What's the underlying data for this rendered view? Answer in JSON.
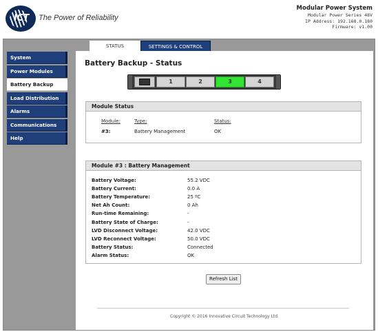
{
  "header": {
    "logo_text": "ICT",
    "tagline": "The Power of Reliability",
    "system_title": "Modular Power System",
    "system_series": "Modular Power Series 48V",
    "ip_address": "IP Address: 192.168.0.180",
    "firmware": "Firmware: v1.00"
  },
  "tabs": [
    {
      "label": "STATUS",
      "active": true
    },
    {
      "label": "SETTINGS & CONTROL",
      "active": false
    }
  ],
  "sidebar": {
    "items": [
      {
        "label": "System",
        "active": false
      },
      {
        "label": "Power Modules",
        "active": false
      },
      {
        "label": "Battery Backup",
        "active": true
      },
      {
        "label": "Load Distribution",
        "active": false
      },
      {
        "label": "Alarms",
        "active": false
      },
      {
        "label": "Communications",
        "active": false
      },
      {
        "label": "Help",
        "active": false
      }
    ]
  },
  "page_title": "Battery Backup - Status",
  "rack": {
    "controller_icon": "controller-screen-icon",
    "slots": [
      "1",
      "2",
      "3",
      "4"
    ],
    "selected_slot": "3",
    "selected_color": "#33e533"
  },
  "module_status": {
    "heading": "Module Status",
    "columns": {
      "module": "Module:",
      "type": "Type:",
      "status": "Status:"
    },
    "row": {
      "module": "#3:",
      "type": "Battery Management",
      "status": "OK"
    }
  },
  "battery_management": {
    "heading": "Module #3 : Battery Management",
    "rows": [
      {
        "label": "Battery Voltage:",
        "value": "55.2 VDC"
      },
      {
        "label": "Battery Current:",
        "value": "0.0 A"
      },
      {
        "label": "Battery Temperature:",
        "value": "25 ºC"
      },
      {
        "label": "Net Ah Count:",
        "value": "0 Ah"
      },
      {
        "label": "Run-time Remaining:",
        "value": "-"
      },
      {
        "label": "Battery State of Charge:",
        "value": "-"
      },
      {
        "label": "LVD Disconnect Voltage:",
        "value": "42.0 VDC"
      },
      {
        "label": "LVD Reconnect Voltage:",
        "value": "50.0 VDC"
      },
      {
        "label": "Battery Status:",
        "value": "Connected"
      },
      {
        "label": "Alarm Status:",
        "value": "OK"
      }
    ]
  },
  "refresh_button": "Refresh List",
  "footer": "Copyright © 2016 Innovative Circuit Technology Ltd.",
  "colors": {
    "nav_blue": "#1f3f7a",
    "frame_gray": "#999999",
    "active_slot_green": "#33e533"
  }
}
